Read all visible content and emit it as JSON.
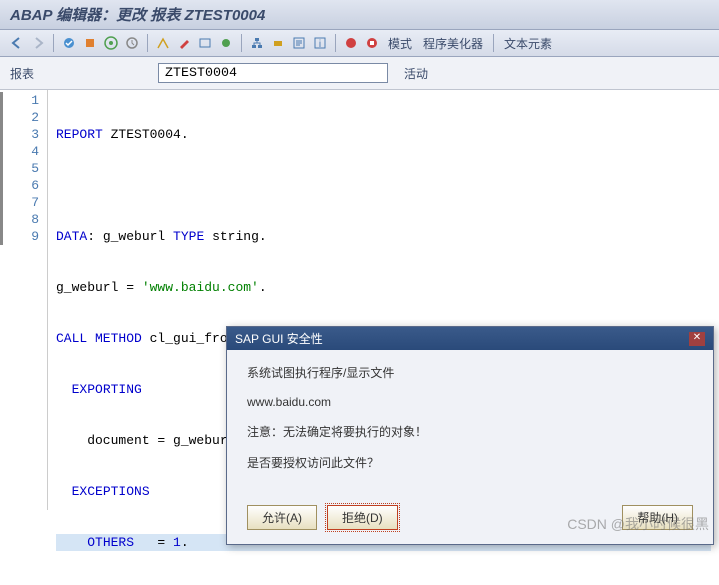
{
  "title": "ABAP 编辑器：更改 报表 ZTEST0004",
  "toolbar": {
    "mode": "模式",
    "beautify": "程序美化器",
    "text_elements": "文本元素"
  },
  "field": {
    "label": "报表",
    "value": "ZTEST0004",
    "status": "活动"
  },
  "code": {
    "lines": [
      "1",
      "2",
      "3",
      "4",
      "5",
      "6",
      "7",
      "8",
      "9"
    ],
    "l1_kw": "REPORT",
    "l1_id": " ZTEST0004.",
    "l3_kw": "DATA",
    "l3_rest": ": g_weburl ",
    "l3_kw2": "TYPE",
    "l3_rest2": " string.",
    "l4_a": "g_weburl = ",
    "l4_str": "'www.baidu.com'",
    "l4_b": ".",
    "l5_kw": "CALL METHOD",
    "l5_rest": " cl_gui_frontend_services=>execute",
    "l6_kw": "EXPORTING",
    "l7": "    document = g_weburl",
    "l8_kw": "EXCEPTIONS",
    "l9_kw": "OTHERS",
    "l9_eq": "   = ",
    "l9_num": "1",
    "l9_dot": "."
  },
  "dialog": {
    "title": "SAP GUI 安全性",
    "line1": "系统试图执行程序/显示文件",
    "line2": "www.baidu.com",
    "line3": "注意：无法确定将要执行的对象！",
    "line4": "是否要授权访问此文件？",
    "allow": "允许(A)",
    "deny": "拒绝(D)",
    "help": "帮助(H)"
  },
  "watermark": "CSDN @我小时候很黑"
}
